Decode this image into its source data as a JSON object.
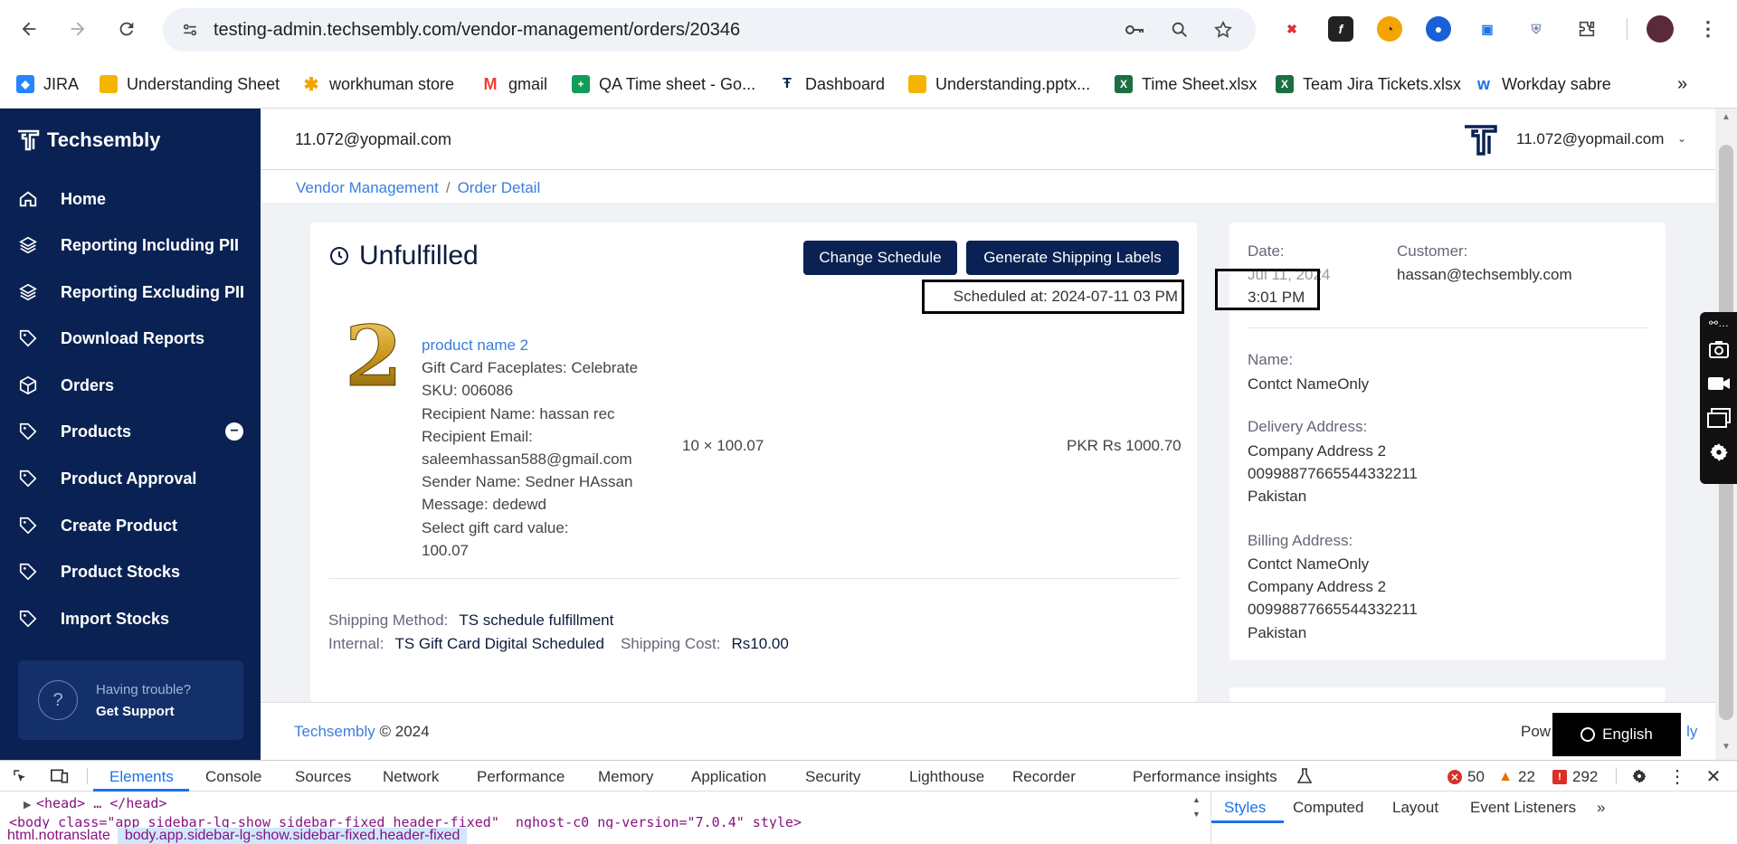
{
  "browser": {
    "url": "testing-admin.techsembly.com/vendor-management/orders/20346",
    "bookmarks": [
      {
        "label": "JIRA",
        "icon": "jira-icon",
        "color": "#2684ff"
      },
      {
        "label": "Understanding Sheet",
        "icon": "slides-icon",
        "color": "#f4b400"
      },
      {
        "label": "workhuman store",
        "icon": "star-icon",
        "color": "#f4a300"
      },
      {
        "label": "gmail",
        "icon": "gmail-icon",
        "color": "#ea4335"
      },
      {
        "label": "QA Time sheet - Go...",
        "icon": "sheets-icon",
        "color": "#0f9d58"
      },
      {
        "label": "Dashboard",
        "icon": "techsembly-icon",
        "color": "#0a2253"
      },
      {
        "label": "Understanding.pptx...",
        "icon": "slides-icon",
        "color": "#f4b400"
      },
      {
        "label": "Time Sheet.xlsx",
        "icon": "excel-icon",
        "color": "#1d6f42"
      },
      {
        "label": "Team Jira Tickets.xlsx",
        "icon": "excel-icon",
        "color": "#1d6f42"
      },
      {
        "label": "Workday sabre",
        "icon": "workday-icon",
        "color": "#f5a623"
      }
    ]
  },
  "app": {
    "brand": "Techsembly",
    "header_email": "11.072@yopmail.com",
    "user_email": "11.072@yopmail.com",
    "sidebar": [
      {
        "label": "Home",
        "icon": "home-icon"
      },
      {
        "label": "Reporting Including PII",
        "icon": "layers-icon"
      },
      {
        "label": "Reporting Excluding PII",
        "icon": "layers-icon"
      },
      {
        "label": "Download Reports",
        "icon": "tag-icon"
      },
      {
        "label": "Orders",
        "icon": "box-icon"
      },
      {
        "label": "Products",
        "icon": "tag-icon",
        "collapse": "−"
      },
      {
        "label": "Product Approval",
        "icon": "tag-icon"
      },
      {
        "label": "Create Product",
        "icon": "tag-icon"
      },
      {
        "label": "Product Stocks",
        "icon": "tag-icon"
      },
      {
        "label": "Import Stocks",
        "icon": "tag-icon"
      }
    ],
    "support": {
      "line1": "Having trouble?",
      "line2": "Get Support",
      "icon_text": "?"
    },
    "breadcrumb": [
      "Vendor Management",
      "Order Detail"
    ],
    "breadcrumb_sep": "/"
  },
  "order": {
    "status": "Unfulfilled",
    "buttons": {
      "change": "Change Schedule",
      "generate": "Generate Shipping Labels"
    },
    "scheduled": "Scheduled at: 2024-07-11 03 PM",
    "product": {
      "image_text": "2",
      "name": "product name 2",
      "lines": [
        "Gift Card Faceplates: Celebrate",
        "SKU: 006086",
        "Recipient Name: hassan rec",
        "Recipient Email:",
        "saleemhassan588@gmail.com",
        "Sender Name: Sedner HAssan",
        "Message: dedewd",
        "Select gift card value:",
        "100.07"
      ],
      "qty": "10 × 100.07",
      "price": "PKR Rs 1000.70"
    },
    "shipping": {
      "method_label": "Shipping Method:",
      "method": "TS schedule fulfillment",
      "internal_label": "Internal:",
      "internal": "TS Gift Card Digital Scheduled",
      "cost_label": "Shipping Cost:",
      "cost": "Rs10.00"
    },
    "details": {
      "date_label": "Date:",
      "date": "Jul 11, 2024",
      "time": "3:01 PM",
      "customer_label": "Customer:",
      "customer": "hassan@techsembly.com",
      "name_label": "Name:",
      "name": "Contct NameOnly",
      "delivery_label": "Delivery Address:",
      "delivery": [
        "Company Address 2",
        "00998877665544332211",
        "Pakistan"
      ],
      "billing_label": "Billing Address:",
      "billing": [
        "Contct NameOnly",
        "Company Address 2",
        "00998877665544332211",
        "Pakistan"
      ]
    }
  },
  "footer": {
    "brand": "Techsembly",
    "copy": "© 2024",
    "powered": "Pow",
    "powered_tail": "ly",
    "language": "English"
  },
  "devtools": {
    "tabs": [
      "Elements",
      "Console",
      "Sources",
      "Network",
      "Performance",
      "Memory",
      "Application",
      "Security",
      "Lighthouse",
      "Recorder",
      "Performance insights"
    ],
    "errors": "50",
    "warnings": "22",
    "issues": "292",
    "code_line1": "<head> … </head>",
    "code_line2": "<body class=\"app sidebar-lg-show sidebar-fixed header-fixed\" _nghost-c0 ng-version=\"7.0.4\" style>",
    "crumbs": [
      "html.notranslate",
      "body.app.sidebar-lg-show.sidebar-fixed.header-fixed"
    ],
    "side_tabs": [
      "Styles",
      "Computed",
      "Layout",
      "Event Listeners"
    ]
  }
}
